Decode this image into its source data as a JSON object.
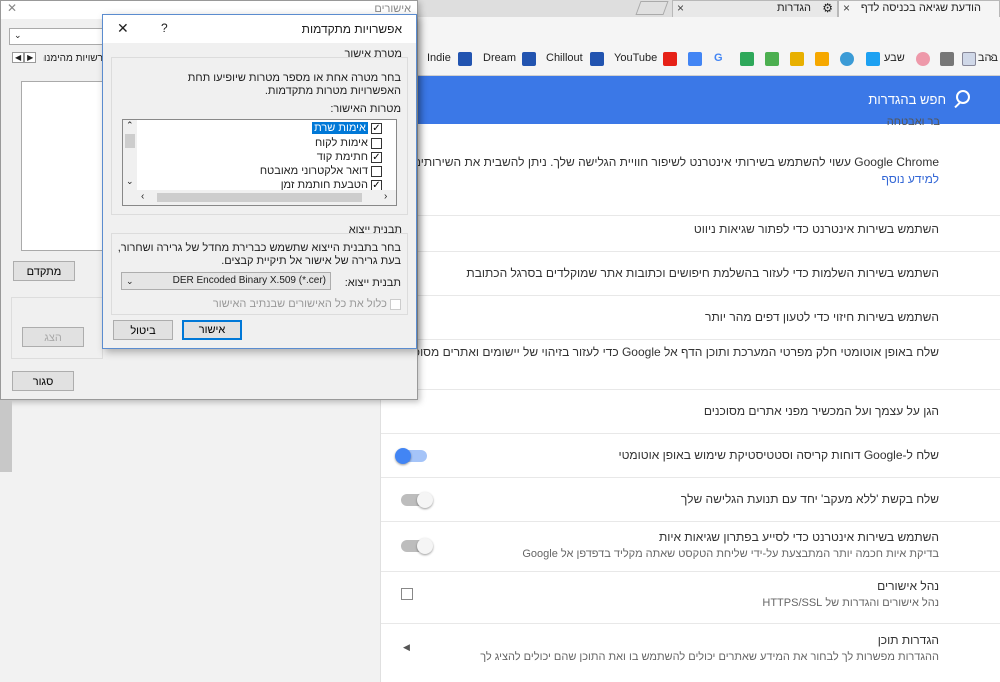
{
  "tabs": [
    {
      "title": "הודעת שגיאה בכניסה לדף",
      "close": "×"
    },
    {
      "title": "הגדרות",
      "close": "×"
    }
  ],
  "bookmarks": [
    "Indie",
    "Dream",
    "Chillout",
    "YouTube",
    "שבע",
    "בהב"
  ],
  "settings": {
    "search_label": "חפש בהגדרות",
    "partial_top": "בר ואבטחה",
    "rows": [
      {
        "title": "Google Chrome עשוי להשתמש בשירותי אינטרנט לשיפור חוויית הגלישה שלך. ניתן להשבית את השירותים האלה",
        "link": "למידע נוסף"
      },
      {
        "title": "השתמש בשירות אינטרנט כדי לפתור שגיאות ניווט"
      },
      {
        "title": "השתמש בשירות השלמות כדי לעזור בהשלמת חיפושים וכתובות אתר שמוקלדים בסרגל הכתובת"
      },
      {
        "title": "השתמש בשירות חיזוי כדי לטעון דפים מהר יותר"
      },
      {
        "title": "שלח באופן אוטומטי חלק מפרטי המערכת ותוכן הדף אל Google כדי לעזור בזיהוי של יישומים ואתרים מסוכנים."
      },
      {
        "title": "הגן על עצמך ועל המכשיר מפני אתרים מסוכנים"
      },
      {
        "title": "שלח ל-Google דוחות קריסה וסטטיסטיקת שימוש באופן אוטומטי"
      },
      {
        "title": "שלח בקשת 'ללא מעקב' יחד עם תנועת הגלישה שלך"
      },
      {
        "title": "השתמש בשירות אינטרנט כדי לסייע בפתרון שגיאות איות",
        "sub": "בדיקת איות חכמה יותר המתבצעת על-ידי שליחת הטקסט שאתה מקליד בדפדפן אל Google"
      },
      {
        "title": "נהל אישורים",
        "sub": "נהל אישורים והגדרות של HTTPS/SSL"
      },
      {
        "title": "הגדרות תוכן",
        "sub": "ההגדרות מפשרות לך לבחור את המידע שאתרים יכולים להשתמש בו ואת התוכן שהם יכולים להציג לך"
      }
    ]
  },
  "cert_dialog": {
    "title": "אישורים",
    "tab_label": "רשויות מהימנות",
    "btn_advanced": "מתקדם",
    "btn_view": "הצג",
    "btn_close": "סגור"
  },
  "adv_dialog": {
    "title": "אפשרויות מתקדמות",
    "help": "?",
    "close": "✕",
    "purpose_group": "מטרת אישור",
    "purpose_desc": "בחר מטרה אחת או מספר מטרות שיופיעו תחת האפשרויות מטרות מתקדמות.",
    "purposes_label": "מטרות האישור:",
    "purposes": [
      {
        "label": "אימות שרת",
        "checked": "✓"
      },
      {
        "label": "אימות לקוח",
        "checked": ""
      },
      {
        "label": "חתימת קוד",
        "checked": "✓"
      },
      {
        "label": "דואר אלקטרוני מאובטח",
        "checked": ""
      },
      {
        "label": "הטבעת חותמת זמן",
        "checked": "✓"
      }
    ],
    "export_group": "תבנית ייצוא",
    "export_desc": "בחר בתבנית הייצוא שתשמש כברירת מחדל של גרירה ושחרור, בעת גרירה של אישור אל תיקיית קבצים.",
    "export_label": "תבנית ייצוא:",
    "export_value": "DER Encoded Binary X.509 (*.cer)",
    "include_chain": "כלול את כל האישורים שבנתיב האישור",
    "ok": "אישור",
    "cancel": "ביטול"
  }
}
